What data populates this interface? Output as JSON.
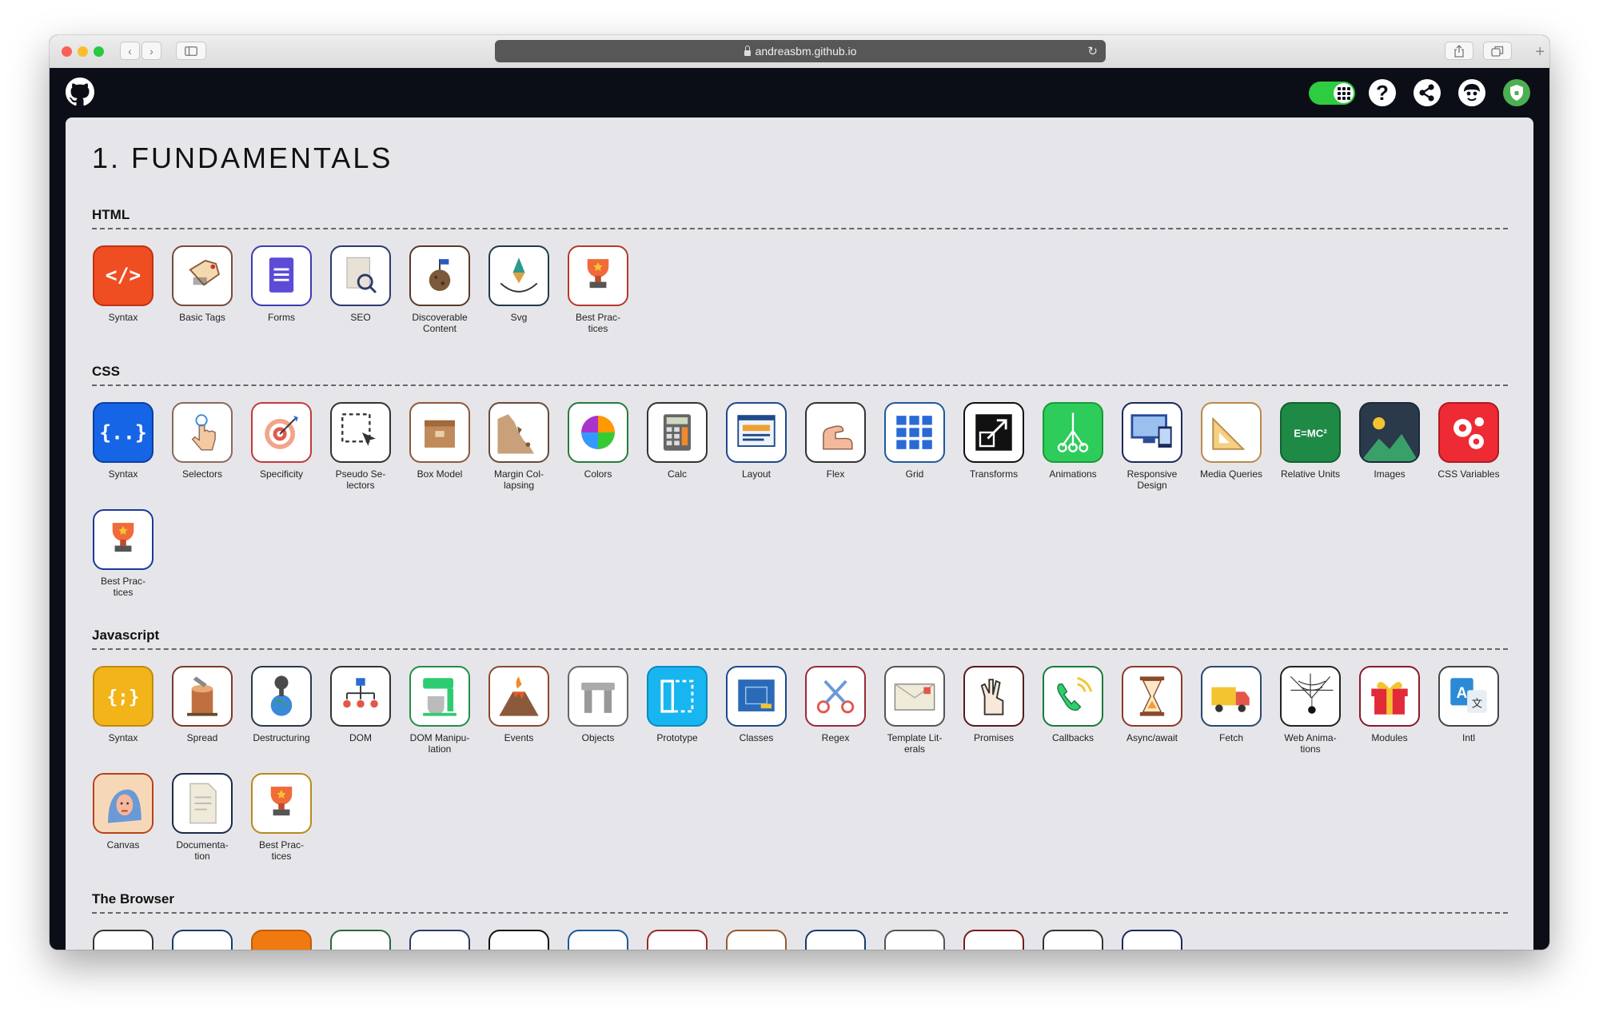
{
  "browser": {
    "url": "andreasbm.github.io"
  },
  "page": {
    "title": "1. FUNDAMENTALS"
  },
  "sections": [
    {
      "name": "HTML",
      "items": [
        {
          "label": "Syntax",
          "icon": "code-brackets-icon",
          "bg": "#ef4e22",
          "border": "#c03212"
        },
        {
          "label": "Basic Tags",
          "icon": "price-tag-icon",
          "bg": "#ffffff",
          "border": "#7a4a3a"
        },
        {
          "label": "Forms",
          "icon": "form-document-icon",
          "bg": "#ffffff",
          "border": "#3d3bb0"
        },
        {
          "label": "SEO",
          "icon": "magnifier-document-icon",
          "bg": "#ffffff",
          "border": "#2a3a6a"
        },
        {
          "label": "Discoverable Content",
          "icon": "planet-flag-icon",
          "bg": "#ffffff",
          "border": "#5a3a2a"
        },
        {
          "label": "Svg",
          "icon": "pen-tool-icon",
          "bg": "#ffffff",
          "border": "#1f3a4a"
        },
        {
          "label": "Best Practices",
          "icon": "trophy-icon",
          "bg": "#ffffff",
          "border": "#b8392a"
        }
      ]
    },
    {
      "name": "CSS",
      "items": [
        {
          "label": "Syntax",
          "icon": "curly-braces-icon",
          "bg": "#1565e6",
          "border": "#0c3fa0"
        },
        {
          "label": "Selectors",
          "icon": "touch-hand-icon",
          "bg": "#ffffff",
          "border": "#8a6a5a"
        },
        {
          "label": "Specificity",
          "icon": "target-icon",
          "bg": "#ffffff",
          "border": "#c03a3a"
        },
        {
          "label": "Pseudo Selectors",
          "icon": "selection-cursor-icon",
          "bg": "#ffffff",
          "border": "#333333"
        },
        {
          "label": "Box Model",
          "icon": "box-icon",
          "bg": "#ffffff",
          "border": "#8a5a3a"
        },
        {
          "label": "Margin Collapsing",
          "icon": "cliff-icon",
          "bg": "#ffffff",
          "border": "#6a4a3a"
        },
        {
          "label": "Colors",
          "icon": "color-wheel-icon",
          "bg": "#ffffff",
          "border": "#2a7a3a"
        },
        {
          "label": "Calc",
          "icon": "calculator-icon",
          "bg": "#ffffff",
          "border": "#333333"
        },
        {
          "label": "Layout",
          "icon": "layout-window-icon",
          "bg": "#ffffff",
          "border": "#1f4a8a"
        },
        {
          "label": "Flex",
          "icon": "flexed-arm-icon",
          "bg": "#ffffff",
          "border": "#333333"
        },
        {
          "label": "Grid",
          "icon": "grid-icon",
          "bg": "#ffffff",
          "border": "#1f5a9a"
        },
        {
          "label": "Transforms",
          "icon": "resize-arrow-icon",
          "bg": "#ffffff",
          "border": "#111111"
        },
        {
          "label": "Animations",
          "icon": "motion-nodes-icon",
          "bg": "#2ecc5a",
          "border": "#1a9a3a"
        },
        {
          "label": "Responsive Design",
          "icon": "devices-icon",
          "bg": "#ffffff",
          "border": "#1a2a5a"
        },
        {
          "label": "Media Queries",
          "icon": "ruler-triangle-icon",
          "bg": "#ffffff",
          "border": "#b88a4a"
        },
        {
          "label": "Relative Units",
          "icon": "chalkboard-formula-icon",
          "bg": "#1e8a46",
          "border": "#14602f"
        },
        {
          "label": "Images",
          "icon": "landscape-image-icon",
          "bg": "#2a3a4a",
          "border": "#1a2a38"
        },
        {
          "label": "CSS Variables",
          "icon": "gears-icon",
          "bg": "#ee2a34",
          "border": "#b01a22"
        },
        {
          "label": "Best Practices",
          "icon": "trophy-icon",
          "bg": "#ffffff",
          "border": "#1a3a9a"
        }
      ]
    },
    {
      "name": "Javascript",
      "items": [
        {
          "label": "Syntax",
          "icon": "curly-semicolon-icon",
          "bg": "#f2b418",
          "border": "#c08a10"
        },
        {
          "label": "Spread",
          "icon": "tree-stump-icon",
          "bg": "#ffffff",
          "border": "#7a3a2a"
        },
        {
          "label": "Destructuring",
          "icon": "earth-explosion-icon",
          "bg": "#ffffff",
          "border": "#2a3a4a"
        },
        {
          "label": "DOM",
          "icon": "tree-diagram-icon",
          "bg": "#ffffff",
          "border": "#333333"
        },
        {
          "label": "DOM Manipulation",
          "icon": "mixer-icon",
          "bg": "#ffffff",
          "border": "#2a8a4a"
        },
        {
          "label": "Events",
          "icon": "volcano-icon",
          "bg": "#ffffff",
          "border": "#8a4a2a"
        },
        {
          "label": "Objects",
          "icon": "stone-arch-icon",
          "bg": "#ffffff",
          "border": "#666666"
        },
        {
          "label": "Prototype",
          "icon": "prototype-frame-icon",
          "bg": "#18b6f0",
          "border": "#0a8ac0"
        },
        {
          "label": "Classes",
          "icon": "blueprint-icon",
          "bg": "#ffffff",
          "border": "#1a4a8a"
        },
        {
          "label": "Regex",
          "icon": "scissors-icon",
          "bg": "#ffffff",
          "border": "#9a2a3a"
        },
        {
          "label": "Template Literals",
          "icon": "envelope-icon",
          "bg": "#ffffff",
          "border": "#555555"
        },
        {
          "label": "Promises",
          "icon": "crossed-fingers-icon",
          "bg": "#ffffff",
          "border": "#5a1a1a"
        },
        {
          "label": "Callbacks",
          "icon": "phone-icon",
          "bg": "#ffffff",
          "border": "#1a7a3a"
        },
        {
          "label": "Async/await",
          "icon": "hourglass-icon",
          "bg": "#ffffff",
          "border": "#8a3a2a"
        },
        {
          "label": "Fetch",
          "icon": "delivery-truck-icon",
          "bg": "#ffffff",
          "border": "#2a4a6a"
        },
        {
          "label": "Web Animations",
          "icon": "spider-web-icon",
          "bg": "#ffffff",
          "border": "#222222"
        },
        {
          "label": "Modules",
          "icon": "gift-icon",
          "bg": "#ffffff",
          "border": "#8a1a2a"
        },
        {
          "label": "Intl",
          "icon": "translate-icon",
          "bg": "#ffffff",
          "border": "#444444"
        },
        {
          "label": "Canvas",
          "icon": "portrait-painting-icon",
          "bg": "#ffffff",
          "border": "#b8401a"
        },
        {
          "label": "Documentation",
          "icon": "document-page-icon",
          "bg": "#ffffff",
          "border": "#1a2a4a"
        },
        {
          "label": "Best Practices",
          "icon": "trophy-icon",
          "bg": "#ffffff",
          "border": "#b88a1a"
        }
      ]
    },
    {
      "name": "The Browser",
      "items": [
        {
          "label": "",
          "icon": "partial-icon",
          "bg": "#ffffff",
          "border": "#333333"
        },
        {
          "label": "",
          "icon": "partial-icon",
          "bg": "#ffffff",
          "border": "#1a3a6a"
        },
        {
          "label": "",
          "icon": "partial-icon",
          "bg": "#f07a10",
          "border": "#c05a08"
        },
        {
          "label": "",
          "icon": "partial-icon",
          "bg": "#ffffff",
          "border": "#2a6a3a"
        },
        {
          "label": "",
          "icon": "partial-icon",
          "bg": "#ffffff",
          "border": "#2a3a6a"
        },
        {
          "label": "",
          "icon": "partial-icon",
          "bg": "#ffffff",
          "border": "#111111"
        },
        {
          "label": "",
          "icon": "partial-icon",
          "bg": "#ffffff",
          "border": "#1a5a9a"
        },
        {
          "label": "",
          "icon": "partial-icon",
          "bg": "#ffffff",
          "border": "#9a2a2a"
        },
        {
          "label": "",
          "icon": "partial-icon",
          "bg": "#ffffff",
          "border": "#9a5a2a"
        },
        {
          "label": "",
          "icon": "partial-icon",
          "bg": "#ffffff",
          "border": "#1a3a6a"
        },
        {
          "label": "",
          "icon": "partial-icon",
          "bg": "#ffffff",
          "border": "#555555"
        },
        {
          "label": "",
          "icon": "partial-icon",
          "bg": "#ffffff",
          "border": "#7a1a1a"
        },
        {
          "label": "",
          "icon": "partial-icon",
          "bg": "#ffffff",
          "border": "#333333"
        },
        {
          "label": "",
          "icon": "partial-icon",
          "bg": "#ffffff",
          "border": "#1a2a5a"
        }
      ]
    }
  ],
  "toolbar_icons": [
    "grid-toggle-icon",
    "help-icon",
    "share-icon",
    "avatar-icon",
    "shield-icon"
  ],
  "colors": {
    "topbar": "#0b0e17",
    "content_bg": "#e6e6ea",
    "toggle_on": "#2ecc40",
    "shield": "#4caf50"
  }
}
